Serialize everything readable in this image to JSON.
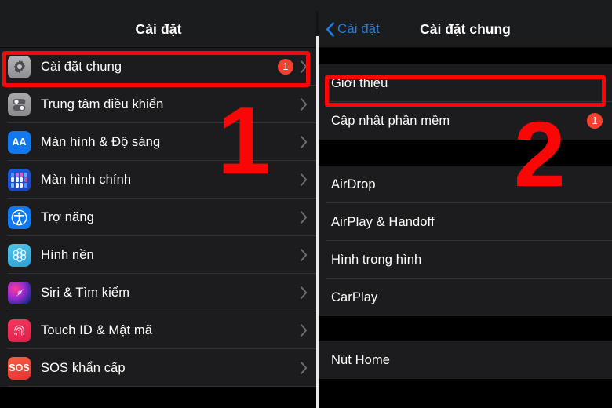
{
  "left_panel": {
    "header_title": "Cài đặt",
    "items": [
      {
        "label": "Cài đặt chung",
        "icon": "gear-icon",
        "badge": "1",
        "chevron": true,
        "highlighted": true
      },
      {
        "label": "Trung tâm điều khiển",
        "icon": "control-center-icon",
        "badge": null,
        "chevron": true,
        "highlighted": false
      },
      {
        "label": "Màn hình & Độ sáng",
        "icon": "display-brightness-icon",
        "badge": null,
        "chevron": true,
        "highlighted": false
      },
      {
        "label": "Màn hình chính",
        "icon": "home-screen-icon",
        "badge": null,
        "chevron": true,
        "highlighted": false
      },
      {
        "label": "Trợ năng",
        "icon": "accessibility-icon",
        "badge": null,
        "chevron": true,
        "highlighted": false
      },
      {
        "label": "Hình nền",
        "icon": "wallpaper-icon",
        "badge": null,
        "chevron": true,
        "highlighted": false
      },
      {
        "label": "Siri & Tìm kiếm",
        "icon": "siri-icon",
        "badge": null,
        "chevron": true,
        "highlighted": false
      },
      {
        "label": "Touch ID & Mật mã",
        "icon": "touch-id-icon",
        "badge": null,
        "chevron": true,
        "highlighted": false
      },
      {
        "label": "SOS khẩn cấp",
        "icon": "sos-icon",
        "badge": null,
        "chevron": true,
        "highlighted": false
      }
    ],
    "icon_glyphs": {
      "display_brightness": "AA",
      "sos": "SOS"
    }
  },
  "right_panel": {
    "back_label": "Cài đặt",
    "back_icon": "chevron-left-icon",
    "header_title": "Cài đặt chung",
    "groups": [
      {
        "items": [
          {
            "label": "Giới thiệu",
            "badge": null,
            "highlighted": true
          },
          {
            "label": "Cập nhật phần mềm",
            "badge": "1",
            "highlighted": false
          }
        ]
      },
      {
        "items": [
          {
            "label": "AirDrop",
            "badge": null,
            "highlighted": false
          },
          {
            "label": "AirPlay & Handoff",
            "badge": null,
            "highlighted": false
          },
          {
            "label": "Hình trong hình",
            "badge": null,
            "highlighted": false
          },
          {
            "label": "CarPlay",
            "badge": null,
            "highlighted": false
          }
        ]
      },
      {
        "items": [
          {
            "label": "Nút Home",
            "badge": null,
            "highlighted": false
          }
        ]
      }
    ]
  },
  "annotations": {
    "marker_one": "1",
    "marker_two": "2",
    "highlight_color": "#fb0606",
    "badge_color": "#f4412e",
    "link_color": "#1f7fe8"
  }
}
